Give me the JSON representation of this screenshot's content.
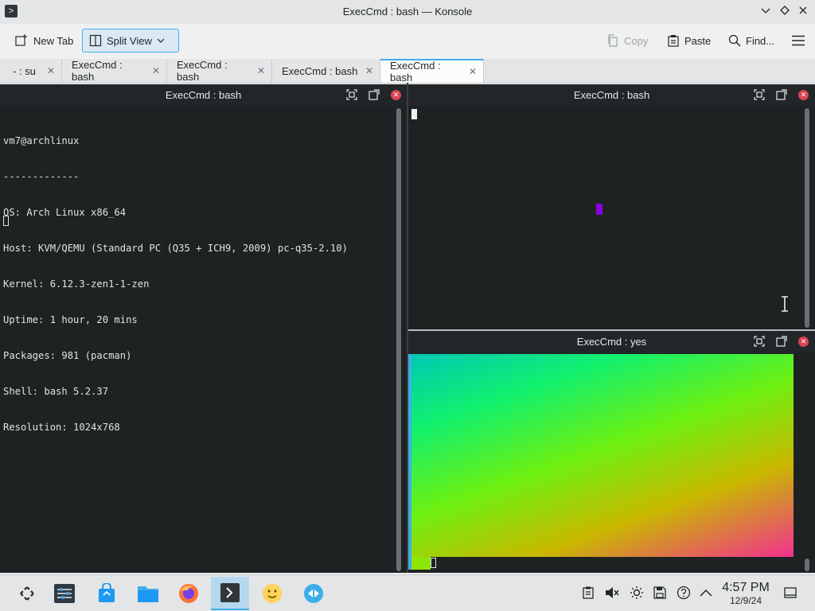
{
  "window": {
    "title": "ExecCmd : bash — Konsole",
    "app_icon": "terminal-icon",
    "controls": [
      "minimize-icon",
      "maximize-icon",
      "close-icon"
    ]
  },
  "toolbar": {
    "new_tab_label": "New Tab",
    "split_view_label": "Split View",
    "copy_label": "Copy",
    "paste_label": "Paste",
    "find_label": "Find...",
    "menu_icon": "hamburger-menu-icon"
  },
  "tabs": [
    {
      "label": "- : su",
      "active": false
    },
    {
      "label": "ExecCmd : bash",
      "active": false
    },
    {
      "label": "ExecCmd : bash",
      "active": false
    },
    {
      "label": "ExecCmd : bash",
      "active": false
    },
    {
      "label": "ExecCmd : bash",
      "active": true
    }
  ],
  "panes": {
    "left": {
      "title": "ExecCmd : bash",
      "lines": [
        "vm7@archlinux",
        "-------------",
        "OS: Arch Linux x86_64",
        "Host: KVM/QEMU (Standard PC (Q35 + ICH9, 2009) pc-q35-2.10)",
        "Kernel: 6.12.3-zen1-1-zen",
        "Uptime: 1 hour, 20 mins",
        "Packages: 981 (pacman)",
        "Shell: bash 5.2.37",
        "Resolution: 1024x768"
      ]
    },
    "top_right": {
      "title": "ExecCmd : bash"
    },
    "bottom_right": {
      "title": "ExecCmd : yes"
    }
  },
  "colors": {
    "accent": "#3daee9",
    "terminal_bg": "#1f2223",
    "close_red": "#da4453",
    "cursor_purple": "#8a00e0"
  },
  "taskbar": {
    "apps": [
      "application-launcher-icon",
      "system-settings-icon",
      "discover-store-icon",
      "file-manager-icon",
      "firefox-icon",
      "konsole-icon",
      "emoji-icon",
      "kde-connect-icon"
    ],
    "tray": [
      "clipboard-icon",
      "volume-muted-icon",
      "brightness-icon",
      "save-icon",
      "help-icon",
      "chevron-up-icon"
    ],
    "clock_time": "4:57 PM",
    "clock_date": "12/9/24"
  }
}
